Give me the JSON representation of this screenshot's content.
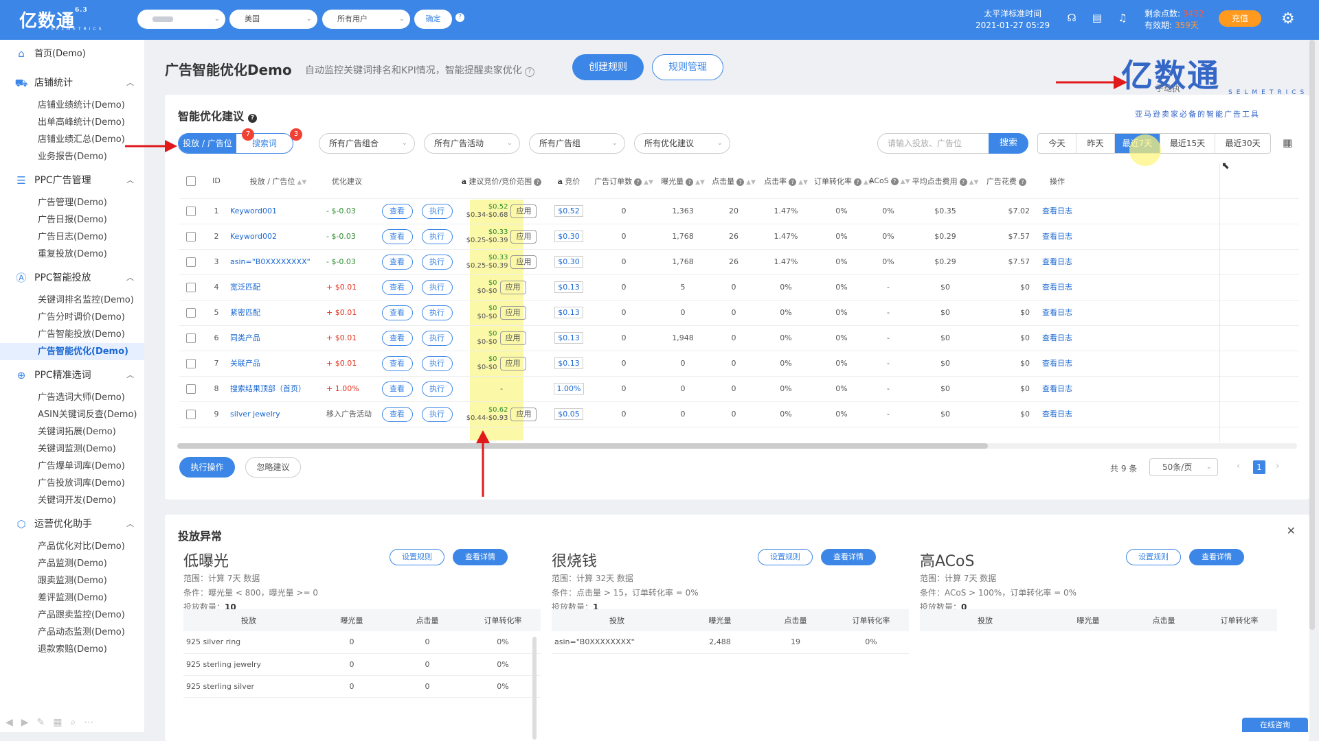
{
  "topbar": {
    "logo": "亿数通",
    "logo_version": "6.3",
    "logo_sub": "SELMETRICS",
    "country": "美国",
    "user_filter": "所有用户",
    "confirm": "确定",
    "tz_label": "太平洋标准时间",
    "datetime": "2021-01-27 05:29",
    "points_label": "剩余点数:",
    "points_value": "3432",
    "validity_label": "有效期:",
    "validity_value": "359天",
    "charge": "充值"
  },
  "sidebar": {
    "home": "首页(Demo)",
    "groups": [
      {
        "title": "店铺统计",
        "items": [
          "店铺业绩统计(Demo)",
          "出单高峰统计(Demo)",
          "店铺业绩汇总(Demo)",
          "业务报告(Demo)"
        ]
      },
      {
        "title": "PPC广告管理",
        "items": [
          "广告管理(Demo)",
          "广告日报(Demo)",
          "广告日志(Demo)",
          "重复投放(Demo)"
        ]
      },
      {
        "title": "PPC智能投放",
        "items": [
          "关键词排名监控(Demo)",
          "广告分时调价(Demo)",
          "广告智能投放(Demo)",
          "广告智能优化(Demo)"
        ]
      },
      {
        "title": "PPC精准选词",
        "items": [
          "广告选词大师(Demo)",
          "ASIN关键词反查(Demo)",
          "关键词拓展(Demo)",
          "关键词监测(Demo)",
          "广告爆单词库(Demo)",
          "广告投放词库(Demo)",
          "关键词开发(Demo)"
        ]
      },
      {
        "title": "运营优化助手",
        "items": [
          "产品优化对比(Demo)",
          "产品监测(Demo)",
          "跟卖监测(Demo)",
          "差评监测(Demo)",
          "产品跟卖监控(Demo)",
          "产品动态监测(Demo)",
          "退款索赔(Demo)"
        ]
      }
    ]
  },
  "header": {
    "title": "广告智能优化Demo",
    "desc": "自动监控关键词排名和KPI情况，智能提醒卖家优化",
    "create_rule": "创建规则",
    "rule_manage": "规则管理",
    "watermark_big": "亿数通",
    "watermark_sub": "SELMETRICS",
    "watermark_tag": "亚马逊卖家必备的智能广告工具",
    "manual_label": "手动执"
  },
  "suggest": {
    "title": "智能优化建议",
    "tab_target": "投放 / 广告位",
    "tab_target_badge": "7",
    "tab_search": "搜索词",
    "tab_search_badge": "3",
    "filters": [
      "所有广告组合",
      "所有广告活动",
      "所有广告组",
      "所有优化建议"
    ],
    "search_placeholder": "请输入投放、广告位",
    "search_btn": "搜索",
    "days": [
      "今天",
      "昨天",
      "最近7天",
      "最近15天",
      "最近30天"
    ],
    "columns": {
      "id": "ID",
      "target": "投放 / 广告位",
      "opt": "优化建议",
      "sug_bid": "建议竞价/竞价范围",
      "bid": "竞价",
      "orders": "广告订单数",
      "impr": "曝光量",
      "clicks": "点击量",
      "ctr": "点击率",
      "cvr": "订单转化率",
      "acos": "ACoS",
      "cpc": "平均点击费用",
      "spend": "广告花费",
      "op": "操作"
    },
    "view_label": "查看",
    "exec_label": "执行",
    "apply_label": "应用",
    "log_label": "查看日志",
    "rows": [
      {
        "id": "1",
        "target": "Keyword001",
        "change": "- $-0.03",
        "sug_top": "$0.52",
        "sug_range": "$0.34-$0.68",
        "bid": "$0.52",
        "orders": "0",
        "impr": "1,363",
        "clicks": "20",
        "ctr": "1.47%",
        "cvr": "0%",
        "acos": "0%",
        "cpc": "$0.35",
        "spend": "$7.02"
      },
      {
        "id": "2",
        "target": "Keyword002",
        "change": "- $-0.03",
        "sug_top": "$0.33",
        "sug_range": "$0.25-$0.39",
        "bid": "$0.30",
        "orders": "0",
        "impr": "1,768",
        "clicks": "26",
        "ctr": "1.47%",
        "cvr": "0%",
        "acos": "0%",
        "cpc": "$0.29",
        "spend": "$7.57"
      },
      {
        "id": "3",
        "target": "asin=\"B0XXXXXXXX\"",
        "change": "- $-0.03",
        "sug_top": "$0.33",
        "sug_range": "$0.25-$0.39",
        "bid": "$0.30",
        "orders": "0",
        "impr": "1,768",
        "clicks": "26",
        "ctr": "1.47%",
        "cvr": "0%",
        "acos": "0%",
        "cpc": "$0.29",
        "spend": "$7.57"
      },
      {
        "id": "4",
        "target": "宽泛匹配",
        "change": "+ $0.01",
        "sug_top": "$0",
        "sug_range": "$0-$0",
        "bid": "$0.13",
        "orders": "0",
        "impr": "5",
        "clicks": "0",
        "ctr": "0%",
        "cvr": "0%",
        "acos": "-",
        "cpc": "$0",
        "spend": "$0"
      },
      {
        "id": "5",
        "target": "紧密匹配",
        "change": "+ $0.01",
        "sug_top": "$0",
        "sug_range": "$0-$0",
        "bid": "$0.13",
        "orders": "0",
        "impr": "0",
        "clicks": "0",
        "ctr": "0%",
        "cvr": "0%",
        "acos": "-",
        "cpc": "$0",
        "spend": "$0"
      },
      {
        "id": "6",
        "target": "同类产品",
        "change": "+ $0.01",
        "sug_top": "$0",
        "sug_range": "$0-$0",
        "bid": "$0.13",
        "orders": "0",
        "impr": "1,948",
        "clicks": "0",
        "ctr": "0%",
        "cvr": "0%",
        "acos": "-",
        "cpc": "$0",
        "spend": "$0"
      },
      {
        "id": "7",
        "target": "关联产品",
        "change": "+ $0.01",
        "sug_top": "$0",
        "sug_range": "$0-$0",
        "bid": "$0.13",
        "orders": "0",
        "impr": "0",
        "clicks": "0",
        "ctr": "0%",
        "cvr": "0%",
        "acos": "-",
        "cpc": "$0",
        "spend": "$0"
      },
      {
        "id": "8",
        "target": "搜索结果顶部（首页）",
        "change": "+ 1.00%",
        "sug_top": "-",
        "sug_range": "",
        "bid": "1.00%",
        "orders": "0",
        "impr": "0",
        "clicks": "0",
        "ctr": "0%",
        "cvr": "0%",
        "acos": "-",
        "cpc": "$0",
        "spend": "$0"
      },
      {
        "id": "9",
        "target": "silver jewelry",
        "change": "移入广告活动",
        "sug_top": "$0.62",
        "sug_range": "$0.44-$0.93",
        "bid": "$0.05",
        "orders": "0",
        "impr": "0",
        "clicks": "0",
        "ctr": "0%",
        "cvr": "0%",
        "acos": "-",
        "cpc": "$0",
        "spend": "$0"
      }
    ],
    "exec_btn": "执行操作",
    "ignore_btn": "忽略建议",
    "total": "共 9 条",
    "page_size": "50条/页",
    "page": "1"
  },
  "anomaly": {
    "title": "投放异常",
    "rule_btn": "设置规则",
    "detail_btn": "查看详情",
    "cols": [
      "投放",
      "曝光量",
      "点击量",
      "订单转化率"
    ],
    "panels": [
      {
        "name": "低曝光",
        "range": "范围：计算 7天 数据",
        "cond": "条件：曝光量 < 800，曝光量 >= 0",
        "count_label": "投放数量：",
        "count": "10",
        "rows": [
          [
            "925 silver ring",
            "0",
            "0",
            "0%"
          ],
          [
            "925 sterling jewelry",
            "0",
            "0",
            "0%"
          ],
          [
            "925 sterling silver",
            "0",
            "0",
            "0%"
          ]
        ]
      },
      {
        "name": "很烧钱",
        "range": "范围：计算 32天 数据",
        "cond": "条件：点击量 > 15，订单转化率 = 0%",
        "count_label": "投放数量：",
        "count": "1",
        "rows": [
          [
            "asin=\"B0XXXXXXXX\"",
            "2,488",
            "19",
            "0%"
          ]
        ]
      },
      {
        "name": "高ACoS",
        "range": "范围：计算 7天 数据",
        "cond": "条件：ACoS > 100%，订单转化率 = 0%",
        "count_label": "投放数量：",
        "count": "0",
        "rows": []
      }
    ]
  },
  "chat": "在线咨询",
  "colors": {
    "primary": "#3b86e6",
    "charge": "#ff9a1f",
    "highlight": "#fbf8a8",
    "arrow": "#e0191b"
  }
}
